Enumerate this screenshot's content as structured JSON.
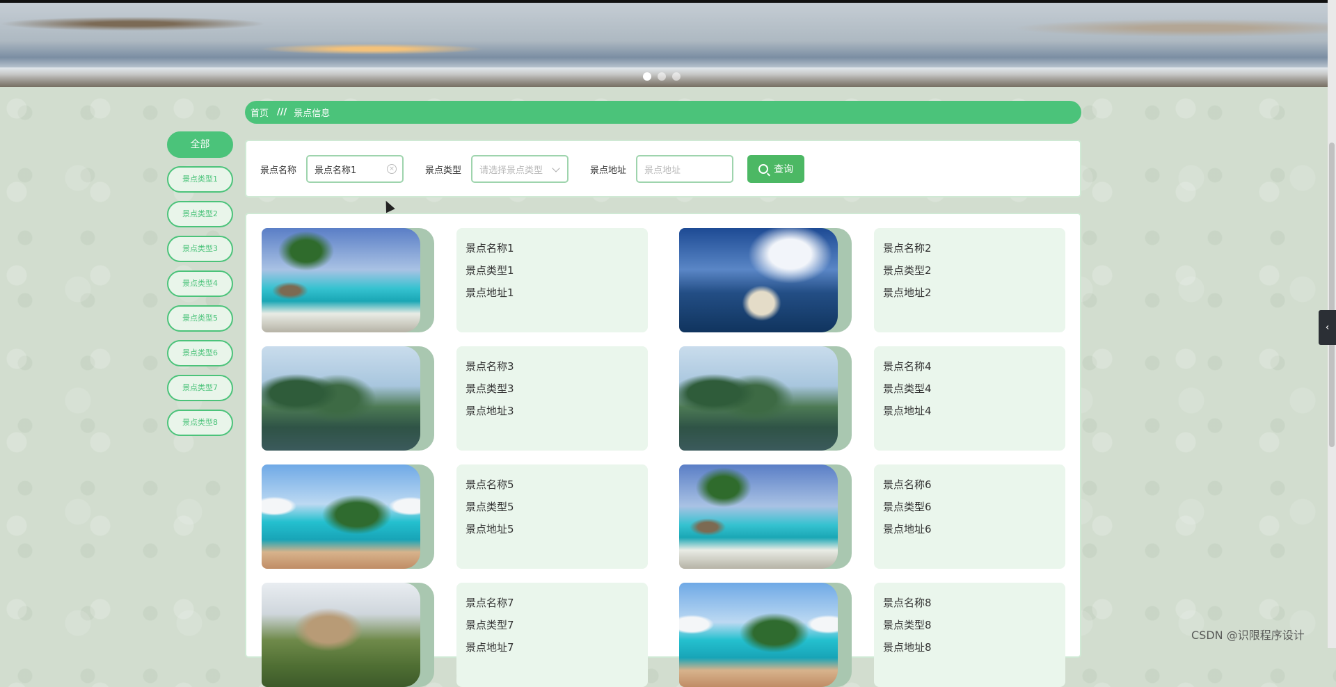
{
  "banner": {
    "dots": [
      {
        "active": true
      },
      {
        "active": false
      },
      {
        "active": false
      }
    ]
  },
  "breadcrumb": {
    "home": "首页",
    "separator": "///",
    "current": "景点信息"
  },
  "sidebar": {
    "items": [
      {
        "label": "全部",
        "active": true
      },
      {
        "label": "景点类型1",
        "active": false
      },
      {
        "label": "景点类型2",
        "active": false
      },
      {
        "label": "景点类型3",
        "active": false
      },
      {
        "label": "景点类型4",
        "active": false
      },
      {
        "label": "景点类型5",
        "active": false
      },
      {
        "label": "景点类型6",
        "active": false
      },
      {
        "label": "景点类型7",
        "active": false
      },
      {
        "label": "景点类型8",
        "active": false
      }
    ]
  },
  "search": {
    "name_label": "景点名称",
    "name_value": "景点名称1",
    "type_label": "景点类型",
    "type_placeholder": "请选择景点类型",
    "address_label": "景点地址",
    "address_placeholder": "景点地址",
    "query_button": "查询"
  },
  "cards": [
    {
      "name": "景点名称1",
      "type": "景点类型1",
      "address": "景点地址1",
      "image": "palm-beach"
    },
    {
      "name": "景点名称2",
      "type": "景点类型2",
      "address": "景点地址2",
      "image": "sea-rock-arch"
    },
    {
      "name": "景点名称3",
      "type": "景点类型3",
      "address": "景点地址3",
      "image": "karst-river"
    },
    {
      "name": "景点名称4",
      "type": "景点类型4",
      "address": "景点地址4",
      "image": "karst-river"
    },
    {
      "name": "景点名称5",
      "type": "景点类型5",
      "address": "景点地址5",
      "image": "balcony-sea"
    },
    {
      "name": "景点名称6",
      "type": "景点类型6",
      "address": "景点地址6",
      "image": "palm-beach"
    },
    {
      "name": "景点名称7",
      "type": "景点类型7",
      "address": "景点地址7",
      "image": "church-hill"
    },
    {
      "name": "景点名称8",
      "type": "景点类型8",
      "address": "景点地址8",
      "image": "balcony-sea"
    }
  ],
  "side_tab": {
    "icon": "chevron-left-icon"
  },
  "watermark": "CSDN @识限程序设计",
  "colors": {
    "accent": "#4bc37a",
    "button": "#4cb864",
    "info_bg": "#eaf6ec"
  }
}
